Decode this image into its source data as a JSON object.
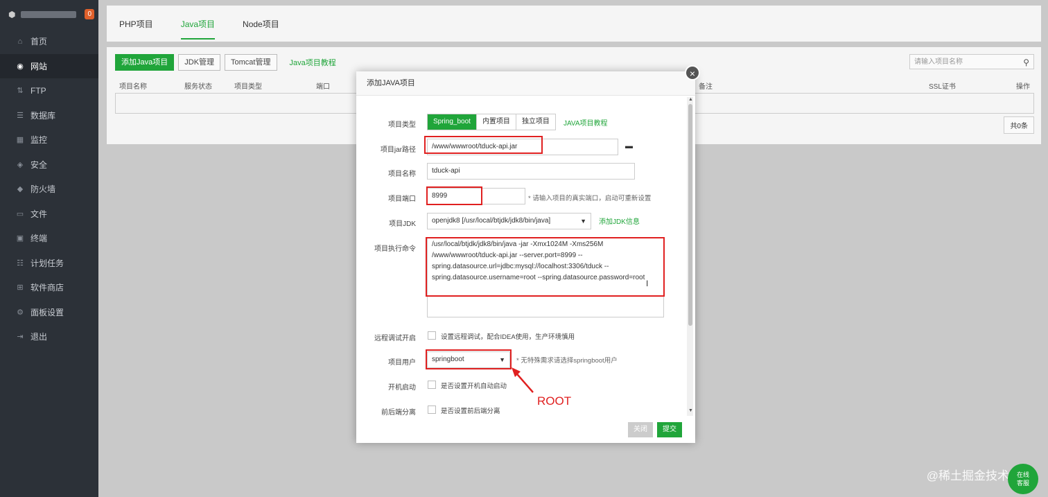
{
  "sidebar": {
    "badge": "0",
    "items": [
      {
        "icon": "home-icon",
        "glyph": "⌂",
        "label": "首页"
      },
      {
        "icon": "globe-icon",
        "glyph": "◉",
        "label": "网站"
      },
      {
        "icon": "ftp-icon",
        "glyph": "⇅",
        "label": "FTP"
      },
      {
        "icon": "database-icon",
        "glyph": "☰",
        "label": "数据库"
      },
      {
        "icon": "monitor-icon",
        "glyph": "▦",
        "label": "监控"
      },
      {
        "icon": "shield-icon",
        "glyph": "◈",
        "label": "安全"
      },
      {
        "icon": "firewall-icon",
        "glyph": "◆",
        "label": "防火墙"
      },
      {
        "icon": "folder-icon",
        "glyph": "▭",
        "label": "文件"
      },
      {
        "icon": "terminal-icon",
        "glyph": "▣",
        "label": "终端"
      },
      {
        "icon": "task-icon",
        "glyph": "☷",
        "label": "计划任务"
      },
      {
        "icon": "store-icon",
        "glyph": "⊞",
        "label": "软件商店"
      },
      {
        "icon": "settings-icon",
        "glyph": "⚙",
        "label": "面板设置"
      },
      {
        "icon": "logout-icon",
        "glyph": "⇥",
        "label": "退出"
      }
    ]
  },
  "tabs": [
    "PHP项目",
    "Java项目",
    "Node项目"
  ],
  "toolbar": {
    "add": "添加Java项目",
    "jdk": "JDK管理",
    "tomcat": "Tomcat管理",
    "tutorial": "Java项目教程",
    "search_placeholder": "请输入项目名称"
  },
  "table": {
    "headers": [
      "项目名称",
      "服务状态",
      "项目类型",
      "端口",
      "备注",
      "SSL证书",
      "操作"
    ],
    "total": "共0条"
  },
  "modal": {
    "title": "添加JAVA项目",
    "type_label": "项目类型",
    "type_options": [
      "Spring_boot",
      "内置项目",
      "独立项目"
    ],
    "type_tutorial": "JAVA项目教程",
    "jar_label": "项目jar路径",
    "jar_value": "/www/wwwroot/tduck-api.jar",
    "name_label": "项目名称",
    "name_value": "tduck-api",
    "port_label": "项目端口",
    "port_value": "8999",
    "port_hint": "* 请输入项目的真实端口，启动可重新设置",
    "jdk_label": "项目JDK",
    "jdk_value": "openjdk8 [/usr/local/btjdk/jdk8/bin/java]",
    "jdk_add": "添加JDK信息",
    "cmd_label": "项目执行命令",
    "cmd_lines": [
      "/usr/local/btjdk/jdk8/bin/java -jar -Xmx1024M -Xms256M",
      "/www/wwwroot/tduck-api.jar --server.port=8999  --",
      "spring.datasource.url=jdbc:mysql://localhost:3306/tduck --",
      "spring.datasource.username=root --spring.datasource.password=root"
    ],
    "debug_label": "远程调试开启",
    "debug_text": "设置远程调试，配合IDEA使用，生产环境慎用",
    "user_label": "项目用户",
    "user_value": "springboot",
    "user_hint": "* 无特殊需求请选择springboot用户",
    "boot_label": "开机启动",
    "boot_text": "是否设置开机自动启动",
    "split_label": "前后端分离",
    "split_text": "是否设置前后端分离",
    "close_btn": "关闭",
    "submit_btn": "提交"
  },
  "annotation": "ROOT",
  "watermark": "@稀土掘金技术社区",
  "help_bubble": [
    "在线",
    "客服"
  ],
  "colors": {
    "accent": "#20a53a",
    "annotation": "#e02020",
    "sidebar": "#2c3138"
  }
}
